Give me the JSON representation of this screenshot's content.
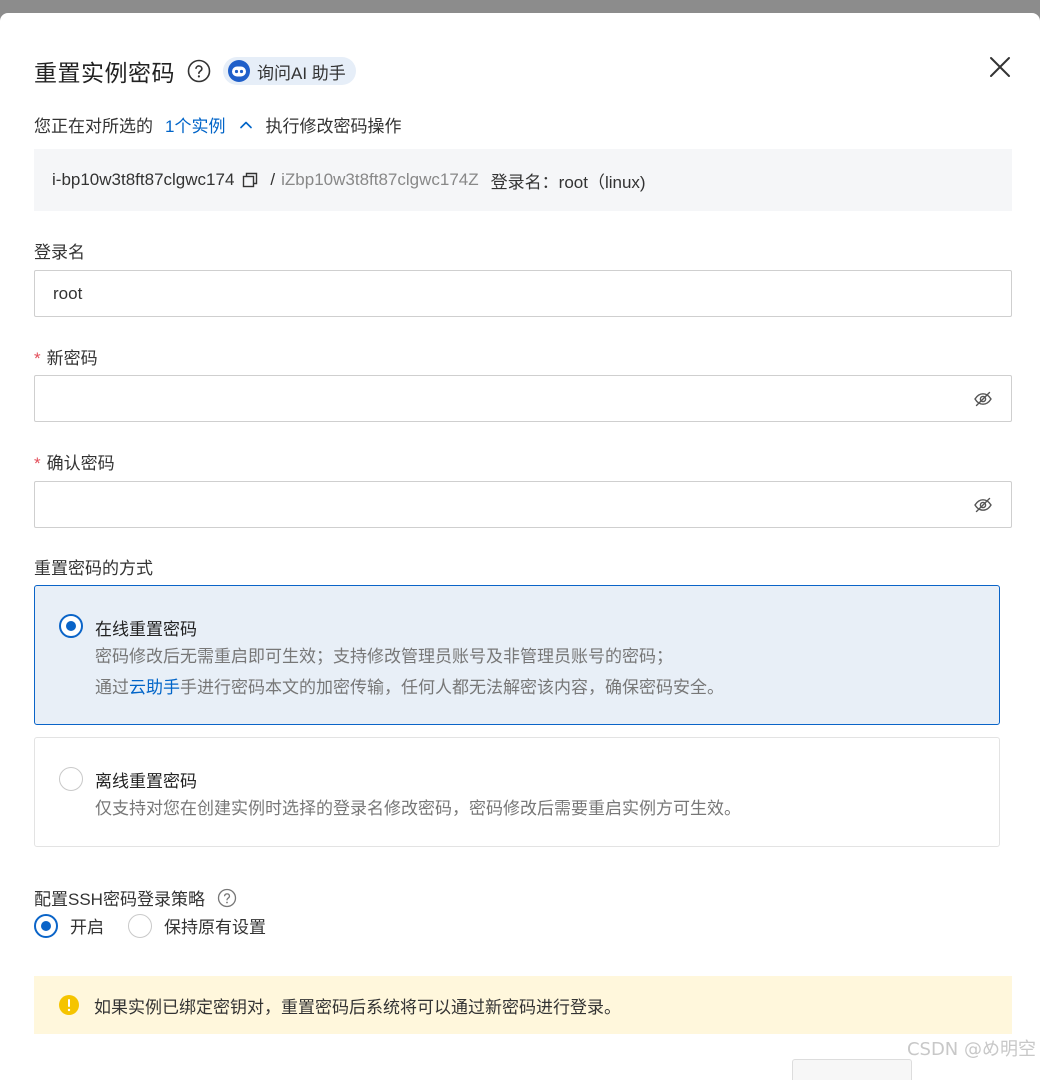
{
  "dialog": {
    "title": "重置实例密码",
    "ai_chip_label": "询问AI 助手"
  },
  "intro": {
    "prefix": "您正在对所选的",
    "instances_link": "1个实例",
    "suffix": "执行修改密码操作"
  },
  "instance": {
    "id": "i-bp10w3t8ft87clgwc174",
    "separator": "/",
    "host_name": "iZbp10w3t8ft87clgwc174Z",
    "login_summary": "登录名：root（linux)"
  },
  "fields": {
    "login_name_label": "登录名",
    "login_name_value": "root",
    "required_mark": "*",
    "new_password_label": "新密码",
    "new_password_value": "",
    "confirm_password_label": "确认密码",
    "confirm_password_value": ""
  },
  "reset_method": {
    "label": "重置密码的方式",
    "online": {
      "title": "在线重置密码",
      "line1": "密码修改后无需重启即可生效；支持修改管理员账号及非管理员账号的密码；",
      "line2_prefix": "通过",
      "line2_link": "云助手",
      "line2_suffix": "手进行密码本文的加密传输，任何人都无法解密该内容，确保密码安全。",
      "selected": true
    },
    "offline": {
      "title": "离线重置密码",
      "line1": "仅支持对您在创建实例时选择的登录名修改密码，密码修改后需要重启实例方可生效。",
      "selected": false
    }
  },
  "ssh_policy": {
    "label": "配置SSH密码登录策略",
    "option_on": "开启",
    "option_keep": "保持原有设置",
    "selected": "开启"
  },
  "warning": {
    "text": "如果实例已绑定密钥对，重置密码后系统将可以通过新密码进行登录。"
  },
  "watermark": "CSDN @め明空",
  "colors": {
    "primary": "#0a64c8",
    "link": "#0064c8",
    "required": "#e34d59",
    "warning_bg": "#fff7dc",
    "warning_icon": "#f5c400",
    "selected_bg": "#e8eff7"
  }
}
